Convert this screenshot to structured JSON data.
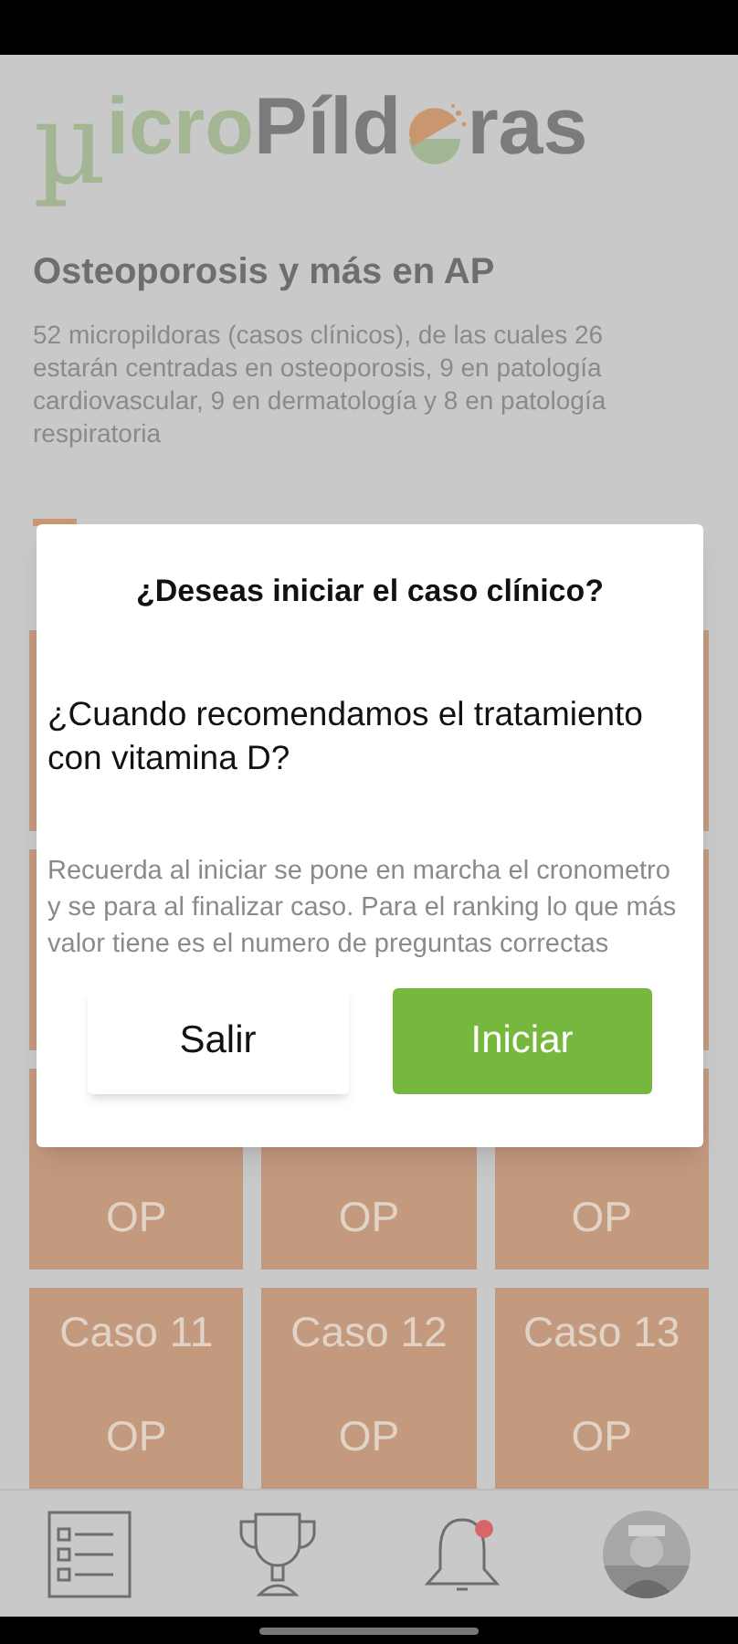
{
  "logo": {
    "mu": "µ",
    "part_1": "icro",
    "part_2": "Píld",
    "part_3": "ras"
  },
  "course": {
    "title": "Osteoporosis y más en AP",
    "description": "52 micropildoras (casos clínicos), de las cuales 26 estarán centradas en osteoporosis, 9 en patología cardiovascular, 9 en dermatología y 8 en patología respiratoria"
  },
  "tiles": [
    {
      "code": "OP"
    },
    {
      "code": "OP"
    },
    {
      "code": "OP"
    },
    {
      "caption": "Caso 11",
      "code": "OP"
    },
    {
      "caption": "Caso 12",
      "code": "OP"
    },
    {
      "caption": "Caso 13",
      "code": "OP"
    }
  ],
  "dialog": {
    "title": "¿Deseas iniciar el caso clínico?",
    "question": "¿Cuando recomendamos el tratamiento con vitamina D?",
    "note": "Recuerda al iniciar se pone en marcha el cronometro y se para al finalizar caso. Para el ranking lo que más valor tiene es el numero de preguntas correctas",
    "buttons": [
      {
        "label": "Salir",
        "kind": "secondary"
      },
      {
        "label": "Iniciar",
        "kind": "primary"
      }
    ]
  },
  "bottom_nav": {
    "notifications_unread": true
  }
}
